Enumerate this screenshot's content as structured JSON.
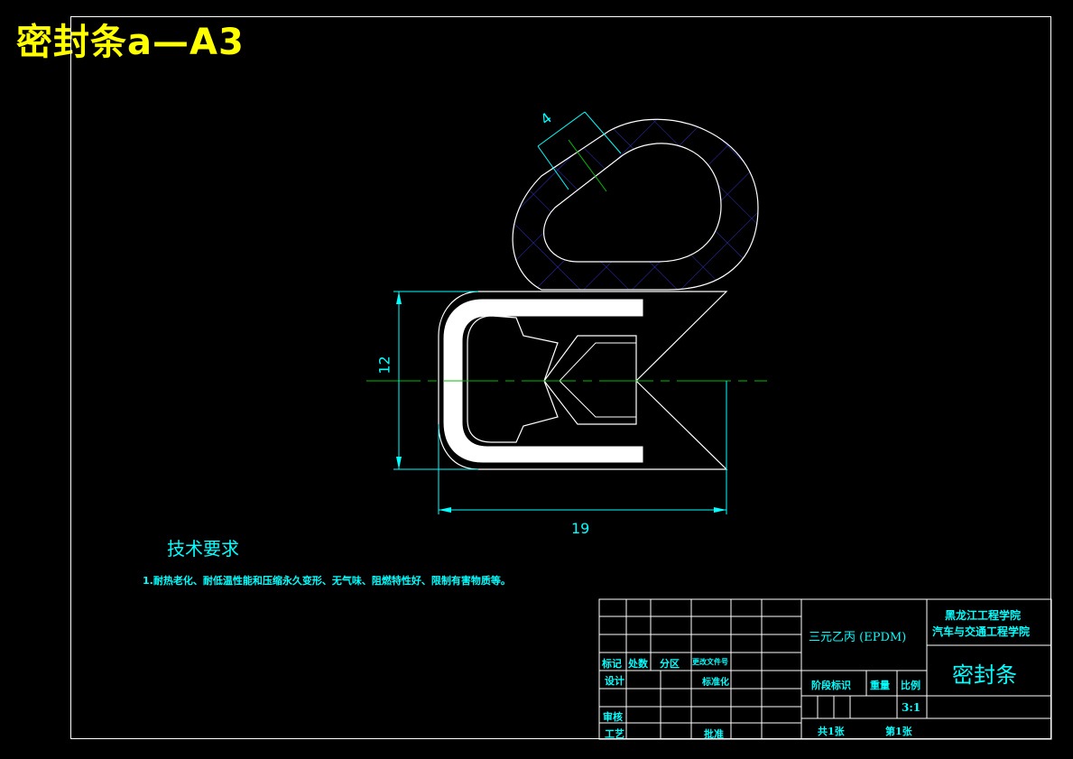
{
  "title": "密封条a—A3",
  "dimensions": {
    "width_label": "19",
    "height_label": "12",
    "thickness_label": "4"
  },
  "tech_requirements": {
    "heading": "技术要求",
    "note": "1.耐热老化、耐低温性能和压缩永久变形、无气味、阻燃特性好、限制有害物质等。"
  },
  "title_block": {
    "material": "三元乙丙 (EPDM)",
    "institution_line1": "黑龙江工程学院",
    "institution_line2": "汽车与交通工程学院",
    "part_name": "密封条",
    "label_mark": "标记",
    "label_count": "处数",
    "label_zone": "分区",
    "label_change_doc": "更改文件号",
    "label_design": "设计",
    "label_standardize": "标准化",
    "label_review": "审核",
    "label_process": "工艺",
    "label_approve": "批准",
    "label_stage": "阶段标识",
    "label_weight": "重量",
    "label_scale": "比例",
    "scale_value": "3:1",
    "sheets_total": "共1张",
    "sheet_number": "第1张"
  },
  "colors": {
    "background": "#000000",
    "title": "#ffff00",
    "frame": "#ffffff",
    "annotation": "#00ffff",
    "centerline": "#00c000",
    "hatch": "#3030c0"
  }
}
